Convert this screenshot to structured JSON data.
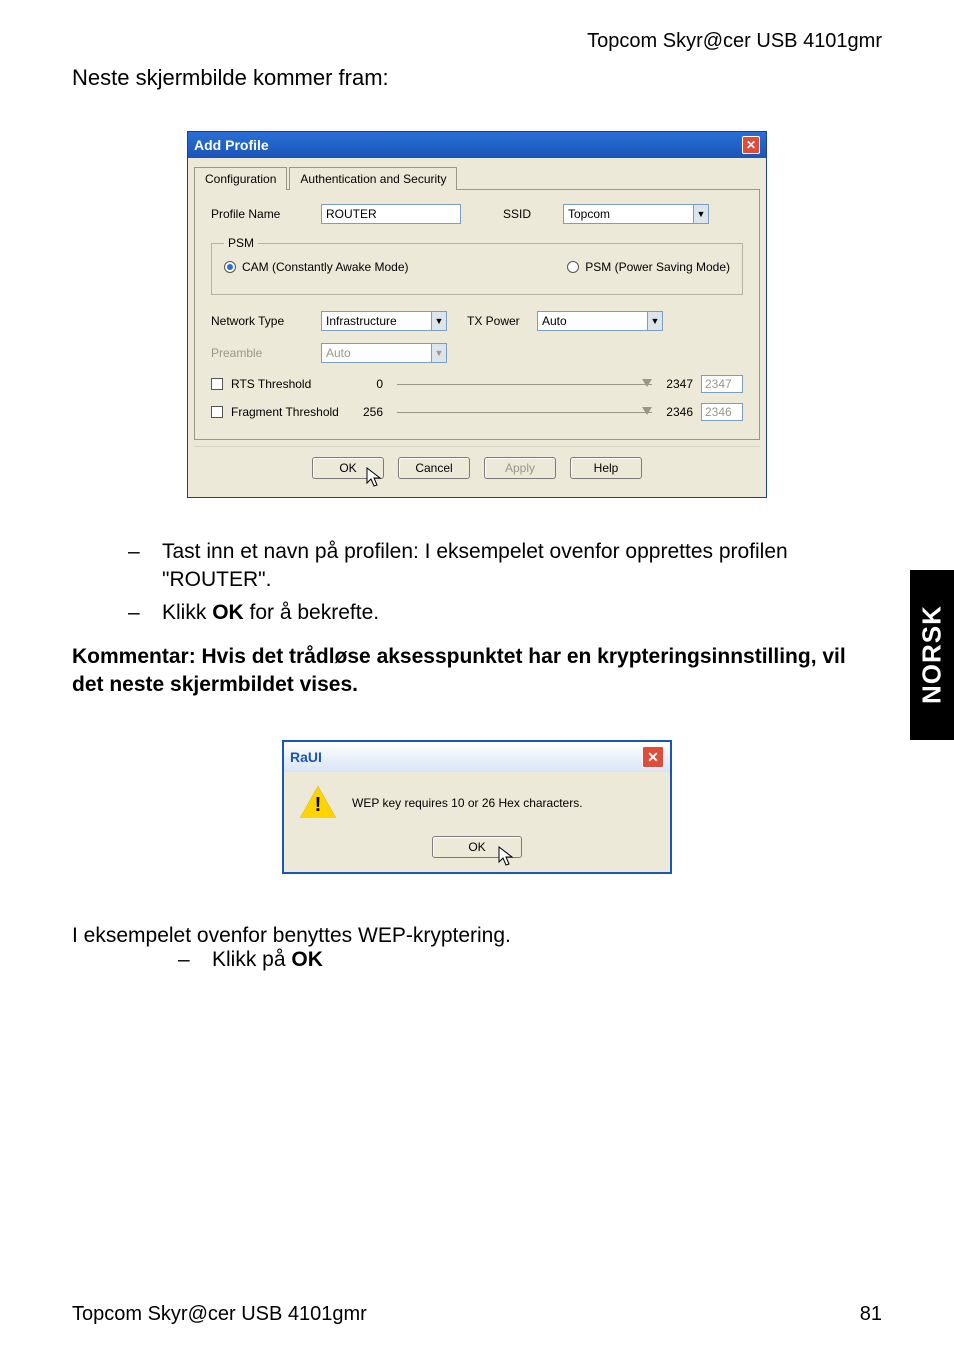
{
  "header_right": "Topcom Skyr@cer USB 4101gmr",
  "intro": "Neste skjermbilde kommer fram:",
  "dialog1": {
    "title": "Add Profile",
    "tabs": {
      "configuration": "Configuration",
      "authSecurity": "Authentication and Security"
    },
    "profileName_label": "Profile Name",
    "profileName_value": "ROUTER",
    "ssid_label": "SSID",
    "ssid_value": "Topcom",
    "psm_legend": "PSM",
    "cam_label": "CAM (Constantly Awake Mode)",
    "psm_label": "PSM (Power Saving Mode)",
    "networkType_label": "Network Type",
    "networkType_value": "Infrastructure",
    "txpower_label": "TX Power",
    "txpower_value": "Auto",
    "preamble_label": "Preamble",
    "preamble_value": "Auto",
    "rts_label": "RTS Threshold",
    "rts_min": "0",
    "rts_max": "2347",
    "rts_value": "2347",
    "frag_label": "Fragment Threshold",
    "frag_min": "256",
    "frag_max": "2346",
    "frag_value": "2346",
    "buttons": {
      "ok": "OK",
      "cancel": "Cancel",
      "apply": "Apply",
      "help": "Help"
    }
  },
  "bullets1": {
    "b1_pre": "Tast inn et navn på profilen: I eksempelet ovenfor opprettes profilen \"ROUTER\".",
    "b2_pre": "Klikk ",
    "b2_bold": "OK",
    "b2_post": " for å bekrefte."
  },
  "note": "Kommentar: Hvis det trådløse aksesspunktet har en krypteringsinnstilling, vil det neste skjermbildet vises.",
  "dialog2": {
    "title": "RaUI",
    "message": "WEP key requires 10 or 26 Hex characters.",
    "ok": "OK"
  },
  "lowerText": "I eksempelet ovenfor benyttes WEP-kryptering.",
  "bullets2": {
    "b1_pre": "Klikk på ",
    "b1_bold": "OK"
  },
  "footer_left": "Topcom Skyr@cer USB 4101gmr",
  "footer_right": "81",
  "side_tab": "NORSK"
}
